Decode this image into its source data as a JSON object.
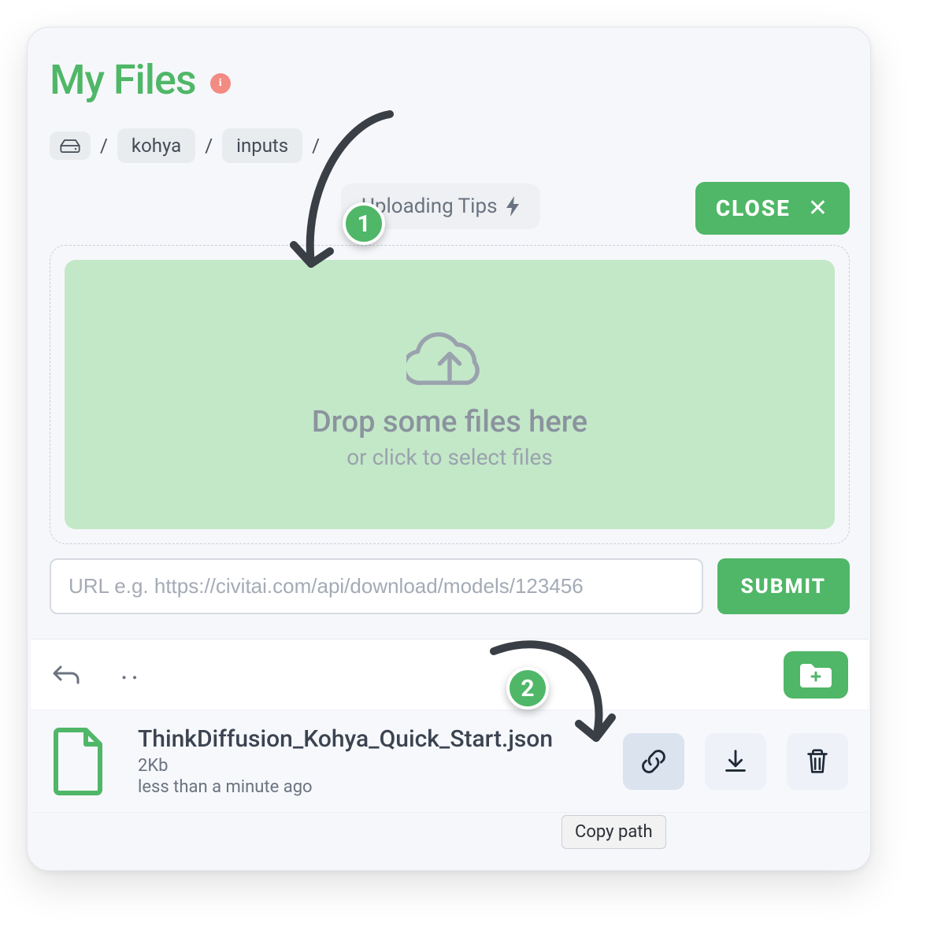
{
  "header": {
    "title": "My Files",
    "info_glyph": "i"
  },
  "breadcrumb": {
    "items": [
      "kohya",
      "inputs"
    ]
  },
  "toolbar": {
    "tips_label": "Uploading Tips",
    "close_label": "CLOSE"
  },
  "dropzone": {
    "main_text": "Drop some files here",
    "sub_text": "or click to select files"
  },
  "url_row": {
    "placeholder": "URL e.g. https://civitai.com/api/download/models/123456",
    "submit_label": "SUBMIT"
  },
  "filelist": {
    "parent_label": "..",
    "file": {
      "name": "ThinkDiffusion_Kohya_Quick_Start.json",
      "size": "2Kb",
      "time": "less than a minute ago"
    }
  },
  "tooltip": {
    "copy_path_label": "Copy path"
  },
  "annotations": {
    "step1": "1",
    "step2": "2"
  }
}
